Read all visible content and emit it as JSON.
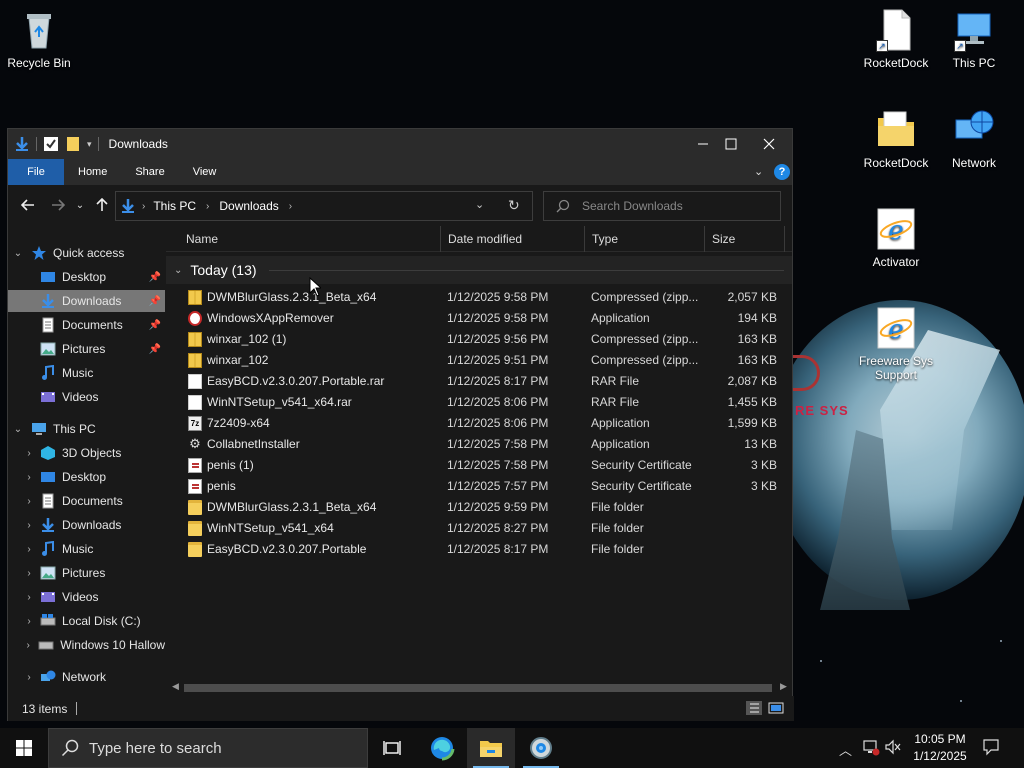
{
  "desktop": {
    "icons": {
      "recycle_bin": "Recycle Bin",
      "rocketdock_1": "RocketDock",
      "this_pc": "This PC",
      "rocketdock_2": "RocketDock",
      "network": "Network",
      "activator": "Activator",
      "freeware": "Freeware Sys Support"
    },
    "wallpaper_text": "RE SYS"
  },
  "window": {
    "title": "Downloads",
    "menu": {
      "file": "File",
      "home": "Home",
      "share": "Share",
      "view": "View"
    },
    "address": {
      "crumb1": "This PC",
      "crumb2": "Downloads"
    },
    "search_placeholder": "Search Downloads",
    "nav": {
      "quick_access": "Quick access",
      "qa_desktop": "Desktop",
      "qa_downloads": "Downloads",
      "qa_documents": "Documents",
      "qa_pictures": "Pictures",
      "qa_music": "Music",
      "qa_videos": "Videos",
      "this_pc": "This PC",
      "pc_3d": "3D Objects",
      "pc_desktop": "Desktop",
      "pc_documents": "Documents",
      "pc_downloads": "Downloads",
      "pc_music": "Music",
      "pc_pictures": "Pictures",
      "pc_videos": "Videos",
      "pc_local_disk": "Local Disk (C:)",
      "pc_win10": "Windows 10 Hallow",
      "network": "Network"
    },
    "columns": {
      "name": "Name",
      "date": "Date modified",
      "type": "Type",
      "size": "Size"
    },
    "group": "Today (13)",
    "files": [
      {
        "name": "DWMBlurGlass.2.3.1_Beta_x64",
        "date": "1/12/2025 9:58 PM",
        "type": "Compressed (zipp...",
        "size": "2,057 KB",
        "icon": "zip"
      },
      {
        "name": "WindowsXAppRemover",
        "date": "1/12/2025 9:58 PM",
        "type": "Application",
        "size": "194 KB",
        "icon": "app-circle"
      },
      {
        "name": "winxar_102 (1)",
        "date": "1/12/2025 9:56 PM",
        "type": "Compressed (zipp...",
        "size": "163 KB",
        "icon": "zip"
      },
      {
        "name": "winxar_102",
        "date": "1/12/2025 9:51 PM",
        "type": "Compressed (zipp...",
        "size": "163 KB",
        "icon": "zip"
      },
      {
        "name": "EasyBCD.v2.3.0.207.Portable.rar",
        "date": "1/12/2025 8:17 PM",
        "type": "RAR File",
        "size": "2,087 KB",
        "icon": "doc"
      },
      {
        "name": "WinNTSetup_v541_x64.rar",
        "date": "1/12/2025 8:06 PM",
        "type": "RAR File",
        "size": "1,455 KB",
        "icon": "doc"
      },
      {
        "name": "7z2409-x64",
        "date": "1/12/2025 8:06 PM",
        "type": "Application",
        "size": "1,599 KB",
        "icon": "7z"
      },
      {
        "name": "CollabnetInstaller",
        "date": "1/12/2025 7:58 PM",
        "type": "Application",
        "size": "13 KB",
        "icon": "gear"
      },
      {
        "name": "penis (1)",
        "date": "1/12/2025 7:58 PM",
        "type": "Security Certificate",
        "size": "3 KB",
        "icon": "cert"
      },
      {
        "name": "penis",
        "date": "1/12/2025 7:57 PM",
        "type": "Security Certificate",
        "size": "3 KB",
        "icon": "cert"
      },
      {
        "name": "DWMBlurGlass.2.3.1_Beta_x64",
        "date": "1/12/2025 9:59 PM",
        "type": "File folder",
        "size": "",
        "icon": "folder"
      },
      {
        "name": "WinNTSetup_v541_x64",
        "date": "1/12/2025 8:27 PM",
        "type": "File folder",
        "size": "",
        "icon": "folder"
      },
      {
        "name": "EasyBCD.v2.3.0.207.Portable",
        "date": "1/12/2025 8:17 PM",
        "type": "File folder",
        "size": "",
        "icon": "folder"
      }
    ],
    "status": "13 items"
  },
  "taskbar": {
    "search_placeholder": "Type here to search",
    "time": "10:05 PM",
    "date": "1/12/2025"
  },
  "colors": {
    "accent": "#1f5ea8",
    "window_bg": "#191919",
    "titlebar_bg": "#2b2b2b",
    "selection": "#777777"
  }
}
